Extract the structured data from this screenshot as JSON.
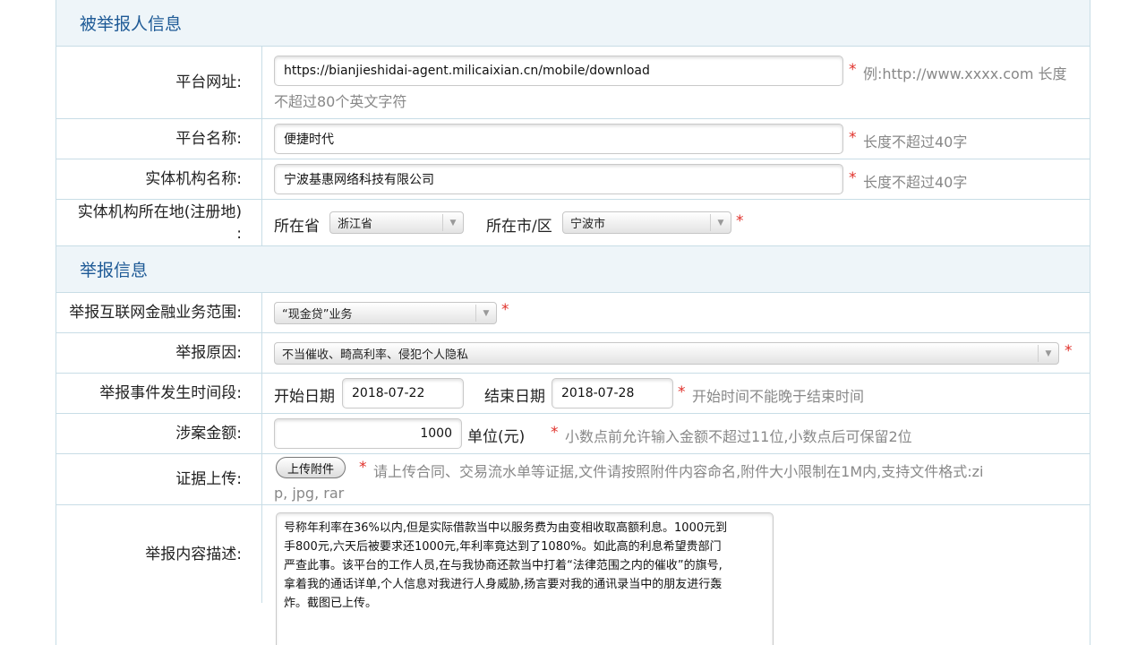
{
  "sections": {
    "reported_party": "被举报人信息",
    "report_info": "举报信息"
  },
  "platform_url": {
    "label": "平台网址:",
    "value": "https://bianjieshidai-agent.milicaixian.cn/mobile/download",
    "required": "*",
    "hint_line1": "例:http://www.xxxx.com 长度",
    "hint_line2": "不超过80个英文字符"
  },
  "platform_name": {
    "label": "平台名称:",
    "value": "便捷时代",
    "required": "*",
    "hint": "长度不超过40字"
  },
  "entity_name": {
    "label": "实体机构名称:",
    "value": "宁波基惠网络科技有限公司",
    "required": "*",
    "hint": "长度不超过40字"
  },
  "entity_location": {
    "label_line1": "实体机构所在地(注册地)",
    "label_line2": ":",
    "province_label": "所在省",
    "province_value": "浙江省",
    "city_label": "所在市/区",
    "city_value": "宁波市",
    "required": "*"
  },
  "business_scope": {
    "label": "举报互联网金融业务范围:",
    "value": "“现金贷”业务",
    "required": "*"
  },
  "report_reason": {
    "label": "举报原因:",
    "value": "不当催收、畸高利率、侵犯个人隐私",
    "required": "*"
  },
  "time_period": {
    "label": "举报事件发生时间段:",
    "start_label": "开始日期",
    "start_value": "2018-07-22",
    "end_label": "结束日期",
    "end_value": "2018-07-28",
    "required": "*",
    "hint": "开始时间不能晚于结束时间"
  },
  "amount": {
    "label": "涉案金额:",
    "value": "1000",
    "unit": "单位(元)",
    "required": "*",
    "hint": "小数点前允许输入金额不超过11位,小数点后可保留2位"
  },
  "evidence": {
    "label": "证据上传:",
    "button": "上传附件",
    "required": "*",
    "hint_line1": "请上传合同、交易流水单等证据,文件请按照附件内容命名,附件大小限制在1M内,支持文件格式:zi",
    "hint_line2": "p, jpg, rar"
  },
  "description": {
    "label": "举报内容描述:",
    "value": "号称年利率在36%以内,但是实际借款当中以服务费为由变相收取高额利息。1000元到\n手800元,六天后被要求还1000元,年利率竟达到了1080%。如此高的利息希望贵部门\n严查此事。该平台的工作人员,在与我协商还款当中打着“法律范围之内的催收”的旗号,\n拿着我的通话详单,个人信息对我进行人身威胁,扬言要对我的通讯录当中的朋友进行轰\n炸。截图已上传。"
  },
  "colors": {
    "section_bg": "#eef5f9",
    "section_text": "#1e5a96",
    "border": "#c8dde6",
    "required": "#e0302a",
    "hint": "#888888"
  }
}
